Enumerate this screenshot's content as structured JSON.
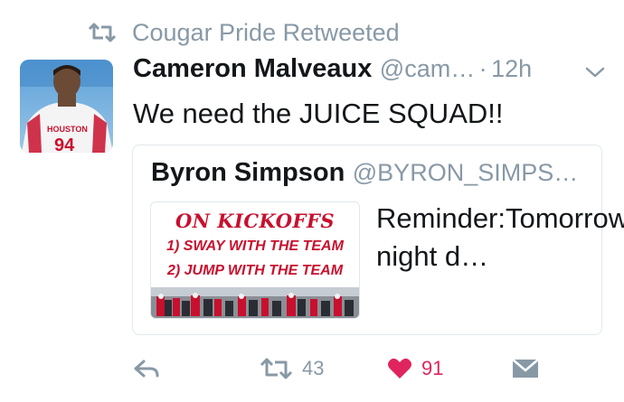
{
  "retweet_header": {
    "text": "Cougar Pride Retweeted"
  },
  "tweet": {
    "author_name": "Cameron Malveaux",
    "author_handle": "@cam…",
    "separator": "·",
    "time": "12h",
    "text": "We need the JUICE SQUAD!!",
    "avatar": {
      "jersey_text": "HOUSTON",
      "number": "94"
    }
  },
  "quoted_tweet": {
    "author_name": "Byron Simpson",
    "author_handle": "@BYRON_SIMPS…",
    "text": "Reminder:Tomorrow night d…",
    "media": {
      "line1": "ON KICKOFFS",
      "line2": "1) SWAY WITH THE TEAM",
      "line3": "2) JUMP WITH THE TEAM"
    }
  },
  "actions": {
    "reply_icon": "reply-icon",
    "retweet_count": "43",
    "like_count": "91",
    "dm_icon": "direct-message-icon"
  },
  "colors": {
    "gray": "#8899a6",
    "text": "#14171a",
    "like": "#e0245e",
    "houston_red": "#c8102e"
  }
}
